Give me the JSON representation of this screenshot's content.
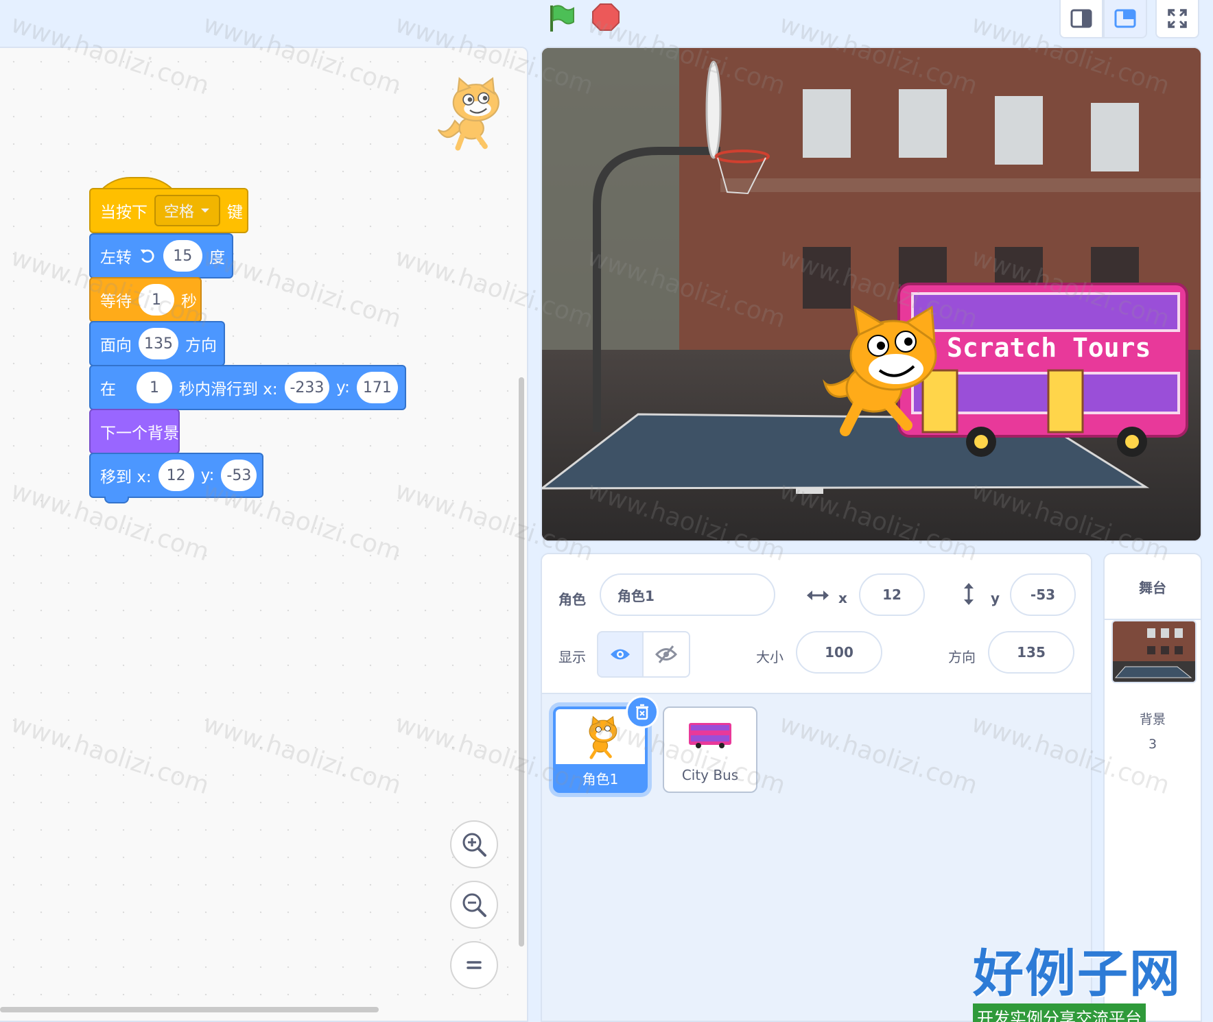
{
  "blocks": {
    "hat": {
      "label": "当按下",
      "key": "空格",
      "suffix": "键"
    },
    "turn": {
      "label": "左转",
      "degrees": "15",
      "suffix": "度"
    },
    "wait": {
      "label": "等待",
      "seconds": "1",
      "suffix": "秒"
    },
    "point": {
      "label": "面向",
      "direction": "135",
      "suffix": "方向"
    },
    "glide": {
      "prefix": "在",
      "seconds": "1",
      "mid": "秒内滑行到 x:",
      "x": "-233",
      "ylabel": "y:",
      "y": "171"
    },
    "next_backdrop": {
      "label": "下一个背景"
    },
    "goto": {
      "label": "移到 x:",
      "x": "12",
      "ylabel": "y:",
      "y": "-53"
    }
  },
  "stage_text": {
    "bus_sign": "Scratch Tours"
  },
  "sprite_info": {
    "sprite_label": "角色",
    "sprite_name": "角色1",
    "x_label": "x",
    "x_value": "12",
    "y_label": "y",
    "y_value": "-53",
    "show_label": "显示",
    "size_label": "大小",
    "size_value": "100",
    "direction_label": "方向",
    "direction_value": "135"
  },
  "sprites": [
    {
      "name": "角色1",
      "selected": true
    },
    {
      "name": "City Bus",
      "selected": false
    }
  ],
  "stage_panel": {
    "title": "舞台",
    "backdrop_label": "背景",
    "backdrop_count": "3"
  },
  "watermark": {
    "text": "www.haolizi.com",
    "logo_main": "好例子网",
    "logo_sub": "开发实例分享交流平台"
  },
  "colors": {
    "events": "#ffbf00",
    "motion": "#4c97ff",
    "control": "#ffab19",
    "looks": "#9966ff"
  }
}
